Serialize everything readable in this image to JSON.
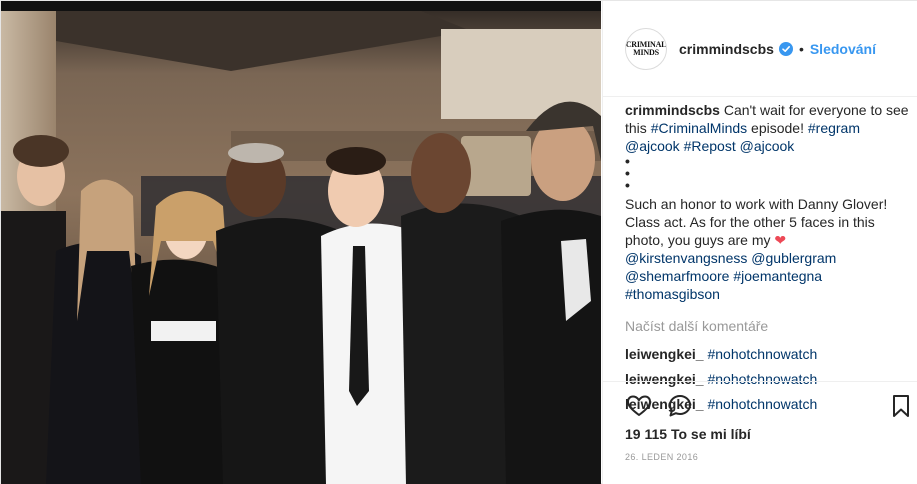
{
  "post": {
    "photo_alt": "",
    "account": {
      "username": "crimmindscbs",
      "avatar_line1": "CRIMINAL",
      "avatar_line2": "MINDS",
      "separator": "•",
      "follow_label": "Sledování"
    },
    "caption": {
      "username": "crimmindscbs",
      "text1": " Can't wait for everyone to see this ",
      "tag1": "#CriminalMinds",
      "text2": " episode! ",
      "tag2": "#regram",
      "tag3": "@ajcook",
      "tag4": "#Repost",
      "tag5": "@ajcook",
      "dots": "•\n•\n•",
      "para2": "Such an honor to work with Danny Glover! Class act. As for the other 5 faces in this photo, you guys are my ",
      "heart": "❤",
      "mentions": [
        "@kirstenvangsness",
        "@gublergram",
        "@shemarfmoore",
        "#joemantegna",
        "#thomasgibson"
      ]
    },
    "load_more_label": "Načíst další komentáře",
    "comments": [
      {
        "user": "leiwengkei_",
        "text": "#nohotchnowatch"
      },
      {
        "user": "leiwengkei_",
        "text": "#nohotchnowatch"
      },
      {
        "user": "leiwengkei_",
        "text": "#nohotchnowatch"
      }
    ],
    "likes_count": "19 115",
    "likes_label": "To se mi líbí",
    "date": "26. LEDEN 2016",
    "colors": {
      "accent": "#3897f0",
      "hashtag": "#003569",
      "muted": "#999999",
      "heart": "#ed4956"
    },
    "icons": [
      "heart-icon",
      "comment-icon",
      "bookmark-icon",
      "verified-badge-icon"
    ]
  }
}
